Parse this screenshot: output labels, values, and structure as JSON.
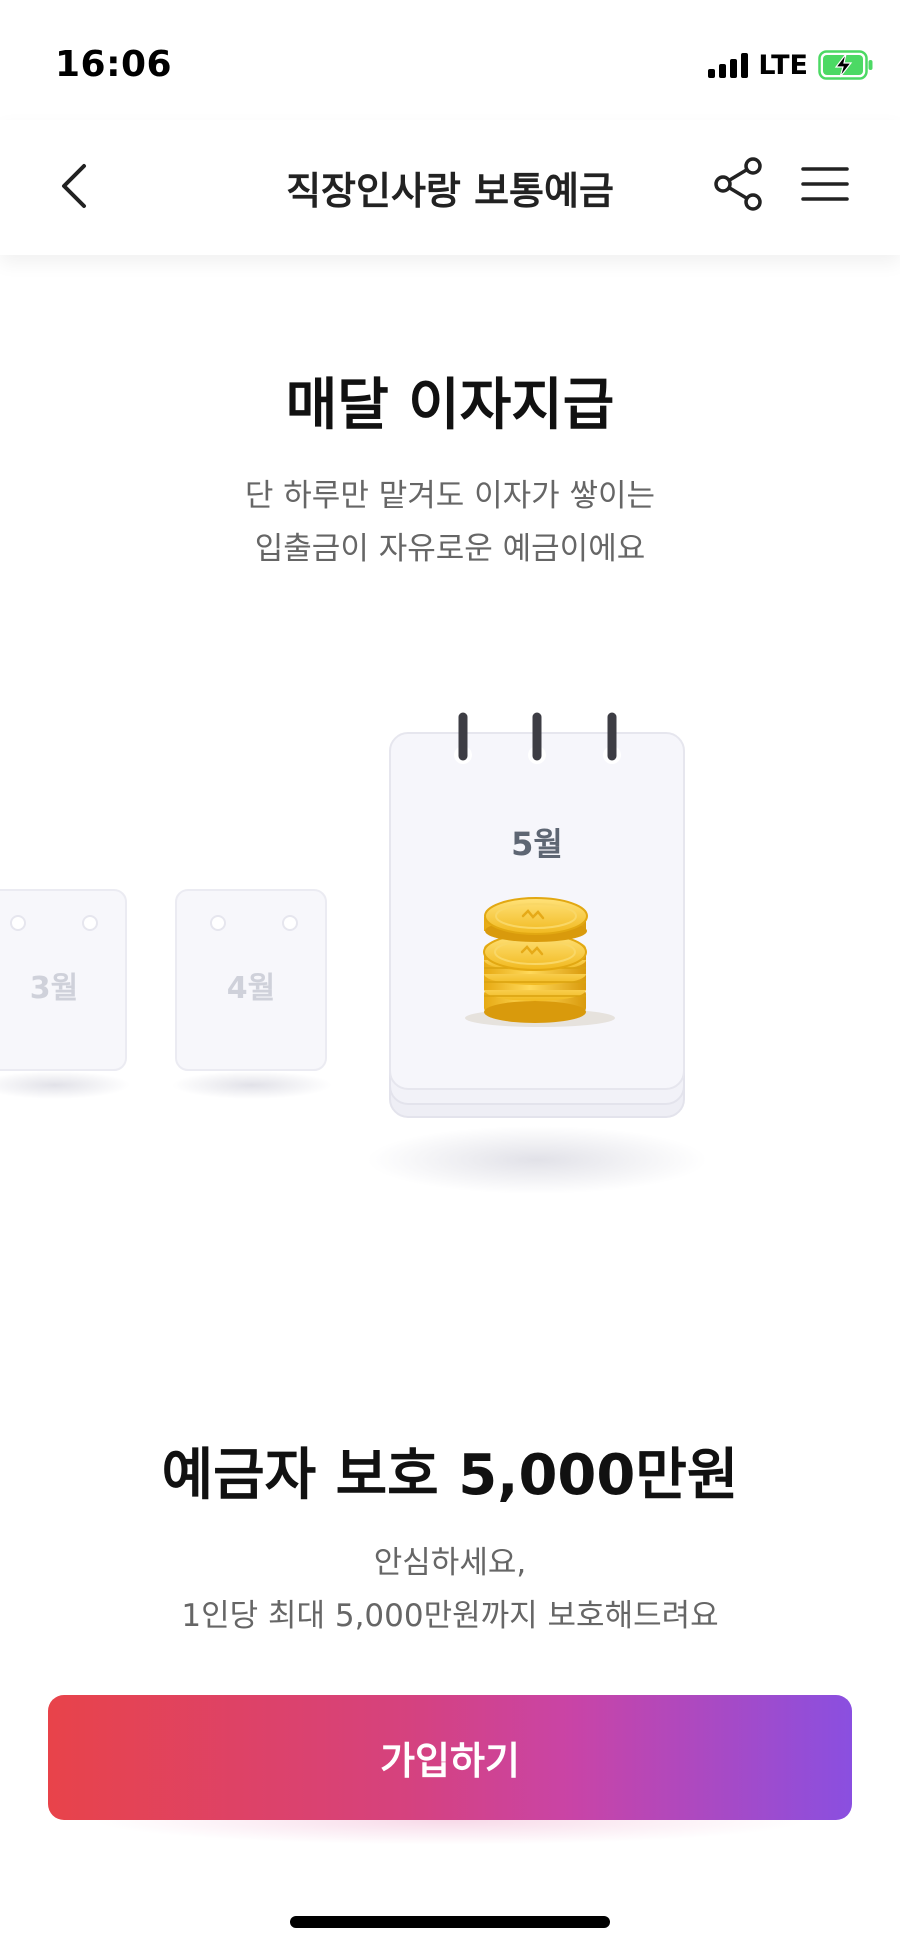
{
  "status_bar": {
    "time": "16:06",
    "network": "LTE"
  },
  "nav": {
    "title": "직장인사랑 보통예금"
  },
  "hero": {
    "title": "매달 이자지급",
    "subtitle_line1": "단 하루만 맡겨도 이자가 쌓이는",
    "subtitle_line2": "입출금이 자유로운 예금이에요"
  },
  "calendar": {
    "months": [
      "3월",
      "4월",
      "5월"
    ]
  },
  "protection": {
    "title": "예금자 보호 5,000만원",
    "subtitle_line1": "안심하세요,",
    "subtitle_line2": "1인당 최대 5,000만원까지 보호해드려요"
  },
  "cta": {
    "label": "가입하기"
  },
  "colors": {
    "cta_start": "#e8434a",
    "cta_end": "#8a4fe0",
    "coin": "#f2c230",
    "battery": "#4cd964"
  }
}
